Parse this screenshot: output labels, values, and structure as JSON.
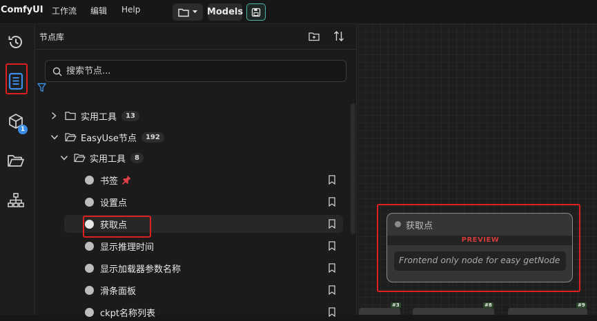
{
  "app": {
    "brand": "ComfyUI",
    "menu": [
      "工作流",
      "编辑",
      "Help"
    ],
    "models_button": "Models"
  },
  "library": {
    "title": "节点库",
    "search_placeholder": "搜索节点..."
  },
  "tree": [
    {
      "label": "实用工具",
      "count": "13",
      "expanded": false
    },
    {
      "label": "EasyUse节点",
      "count": "192",
      "expanded": true
    },
    {
      "label": "实用工具",
      "count": "8",
      "expanded": true
    }
  ],
  "nodes": [
    {
      "label": "书签",
      "active": false
    },
    {
      "label": "设置点",
      "active": false
    },
    {
      "label": "获取点",
      "active": true
    },
    {
      "label": "显示推理时间",
      "active": false
    },
    {
      "label": "显示加载器参数名称",
      "active": false
    },
    {
      "label": "滑条面板",
      "active": false
    },
    {
      "label": "ckpt名称列表",
      "active": false
    }
  ],
  "rail": {
    "queue_badge": "1"
  },
  "preview": {
    "node_title": "获取点",
    "label": "PREVIEW",
    "field_text": "Frontend only node for easy getNode"
  },
  "canvas_tags": [
    "#3",
    "#8",
    "#9"
  ],
  "colors": {
    "accent_blue": "#3b8ee8",
    "highlight_red": "#e02020",
    "save_green": "#4fb6a8",
    "preview_red": "#d13b3b"
  }
}
